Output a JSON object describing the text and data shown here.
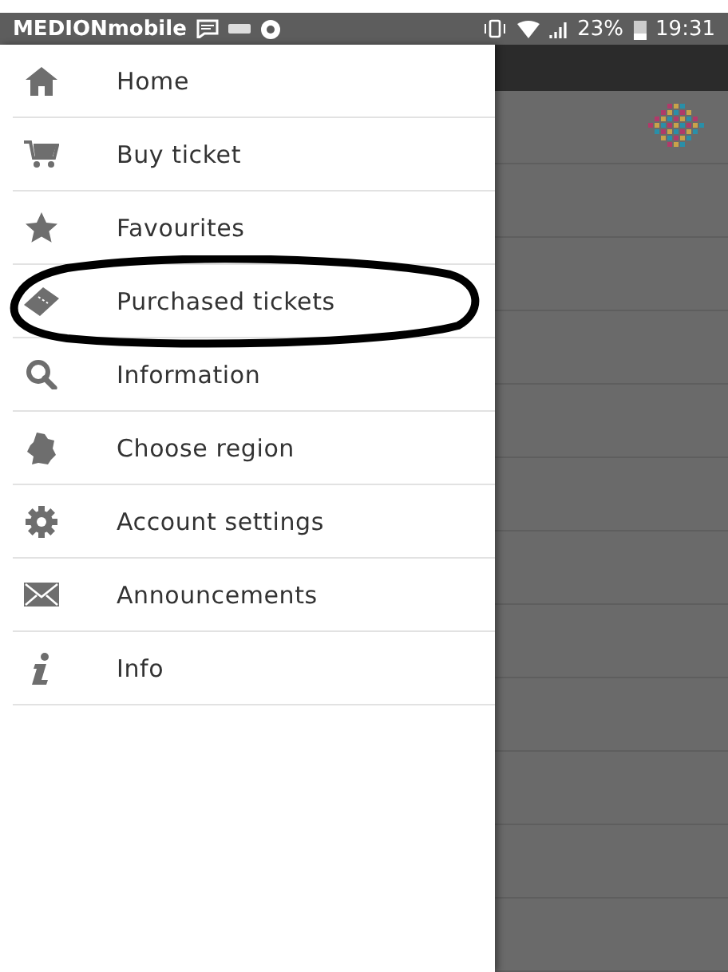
{
  "status_bar": {
    "carrier": "MEDIONmobile",
    "battery": "23%",
    "time": "19:31"
  },
  "drawer": {
    "items": [
      {
        "label": "Home",
        "kind": "home",
        "circled": false
      },
      {
        "label": "Buy ticket",
        "kind": "cart",
        "circled": false
      },
      {
        "label": "Favourites",
        "kind": "star",
        "circled": false
      },
      {
        "label": "Purchased tickets",
        "kind": "ticket",
        "circled": true
      },
      {
        "label": "Information",
        "kind": "search",
        "circled": false
      },
      {
        "label": "Choose region",
        "kind": "map",
        "circled": false
      },
      {
        "label": "Account settings",
        "kind": "gear",
        "circled": false
      },
      {
        "label": "Announcements",
        "kind": "mail",
        "circled": false
      },
      {
        "label": "Info",
        "kind": "info",
        "circled": false
      }
    ]
  }
}
